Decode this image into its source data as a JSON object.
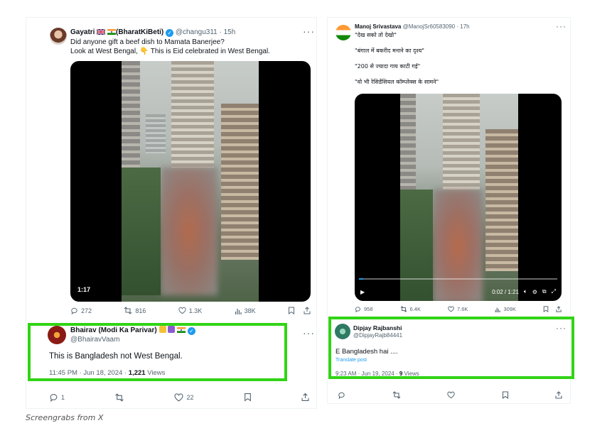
{
  "left_tweet": {
    "author_name": "Gayatri",
    "author_suffix": "(BharatKiBeti)",
    "handle": "@changu311",
    "time": "· 15h",
    "text_line1": "Did anyone gift a beef dish to Mamata Banerjee?",
    "text_line2_a": "Look at West Bengal,",
    "text_line2_b": "This is Eid celebrated in West Bengal.",
    "video_duration": "1:17",
    "replies": "272",
    "retweets": "816",
    "likes": "1.3K",
    "views": "38K"
  },
  "left_reply": {
    "author_name": "Bhairav (Modi Ka Parivar)",
    "handle": "@BhairavVaam",
    "text": "This is Bangladesh not  West Bengal.",
    "time": "11:45 PM · Jun 18, 2024 ·",
    "views_count": "1,221",
    "views_label": "Views",
    "replies": "1",
    "likes": "22"
  },
  "right_tweet": {
    "author_name": "Manoj Srivastava",
    "handle": "@ManojSr60583090",
    "time": "· 17h",
    "line1": "\"देख सको तो देखो\"",
    "line2": "\"बंगाल में बकरीद मनाने का दृश्य\"",
    "line3": "\"200 से ज्यादा गाय काटी गई\"",
    "line4": "\"वो भी रेसिडेंसियल कॉम्प्लेक्स के सामने\"",
    "video_time": "0:02 / 1:21",
    "replies": "958",
    "retweets": "6.4K",
    "likes": "7.6K",
    "views": "309K"
  },
  "right_reply": {
    "author_name": "Dipjay Rajbanshi",
    "handle": "@DipjayRajb84441",
    "text": "E Bangladesh hai ....",
    "translate": "Translate post",
    "time": "9:23 AM · Jun 19, 2024 ·",
    "views_count": "9",
    "views_label": "Views"
  },
  "caption": "Screengrabs from X",
  "colors": {
    "highlight": "#31d415",
    "verified": "#1d9bf0",
    "muted": "#536471"
  }
}
